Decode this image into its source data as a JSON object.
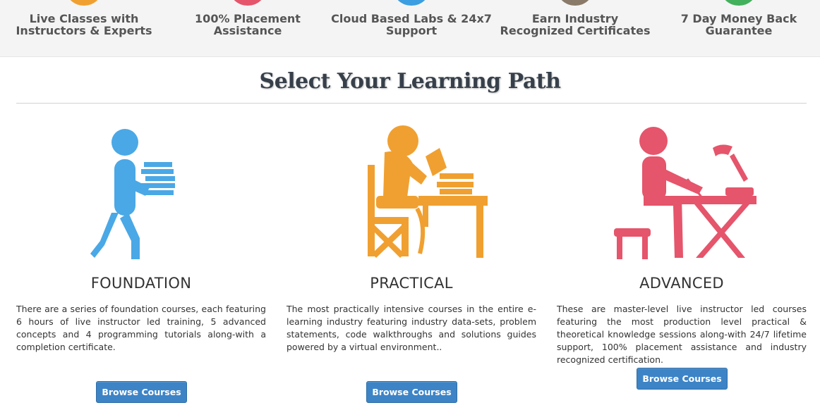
{
  "features": [
    {
      "line1": "Live Classes with",
      "line2": "Instructors & Experts",
      "color": "#f0a030"
    },
    {
      "line1": "100% Placement",
      "line2": "Assistance",
      "color": "#e5556b"
    },
    {
      "line1": "Cloud Based Labs & 24x7",
      "line2": "Support",
      "color": "#3b9ee0"
    },
    {
      "line1": "Earn Industry",
      "line2": "Recognized Certificates",
      "color": "#8a7a6a"
    },
    {
      "line1": "7 Day Money Back",
      "line2": "Guarantee",
      "color": "#43b05c"
    }
  ],
  "section": {
    "title": "Select Your Learning Path"
  },
  "paths": [
    {
      "name": "FOUNDATION",
      "description": "There are a series of foundation courses, each featuring 6 hours of live instructor led training, 5 advanced concepts and 4 programming tutorials along-with a completion certificate.",
      "button": "Browse Courses",
      "color": "#4aa8e6",
      "icon": "person-carrying-books-icon"
    },
    {
      "name": "PRACTICAL",
      "description": "The most practically intensive courses in the entire e-learning industry featuring industry data-sets, problem statements, code walkthroughs and solutions guides powered by a virtual environment..",
      "button": "Browse Courses",
      "color": "#f0a030",
      "icon": "person-reading-at-desk-icon"
    },
    {
      "name": "ADVANCED",
      "description": "These are master-level live instructor led courses featuring the most production level practical & theoretical knowledge sessions along-with 24/7 lifetime support, 100% placement assistance and industry recognized certification.",
      "button": "Browse Courses",
      "color": "#e5556b",
      "icon": "person-writing-at-lamp-desk-icon"
    }
  ]
}
